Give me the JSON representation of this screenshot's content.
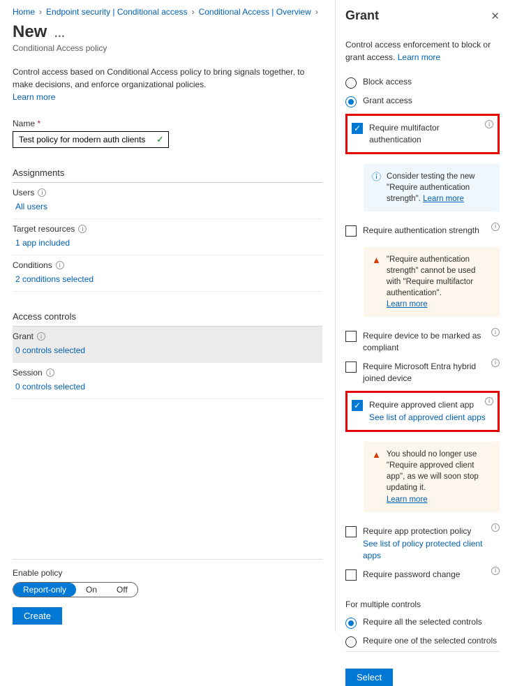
{
  "breadcrumb": [
    "Home",
    "Endpoint security | Conditional access",
    "Conditional Access | Overview"
  ],
  "page": {
    "title": "New",
    "subtitle": "Conditional Access policy",
    "intro": "Control access based on Conditional Access policy to bring signals together, to make decisions, and enforce organizational policies.",
    "learn_more": "Learn more"
  },
  "name": {
    "label": "Name",
    "value": "Test policy for modern auth clients"
  },
  "assignments": {
    "heading": "Assignments",
    "users_label": "Users",
    "users_value": "All users",
    "target_label": "Target resources",
    "target_value": "1 app included",
    "conditions_label": "Conditions",
    "conditions_value": "2 conditions selected"
  },
  "access": {
    "heading": "Access controls",
    "grant_label": "Grant",
    "grant_value": "0 controls selected",
    "session_label": "Session",
    "session_value": "0 controls selected"
  },
  "footer": {
    "enable_label": "Enable policy",
    "opt_report": "Report-only",
    "opt_on": "On",
    "opt_off": "Off",
    "create": "Create"
  },
  "blade": {
    "title": "Grant",
    "desc": "Control access enforcement to block or grant access.",
    "learn_more": "Learn more",
    "block": "Block access",
    "grant": "Grant access",
    "mfa": "Require multifactor authentication",
    "tip_strength": "Consider testing the new \"Require authentication strength\".",
    "strength": "Require authentication strength",
    "warn_strength": "\"Require authentication strength\" cannot be used with \"Require multifactor authentication\".",
    "compliant": "Require device to be marked as compliant",
    "hybrid": "Require Microsoft Entra hybrid joined device",
    "approved_app": "Require approved client app",
    "approved_link": "See list of approved client apps",
    "warn_approved": "You should no longer use \"Require approved client app\", as we will soon stop updating it.",
    "app_protection": "Require app protection policy",
    "app_protection_link": "See list of policy protected client apps",
    "password": "Require password change",
    "multi_heading": "For multiple controls",
    "multi_all": "Require all the selected controls",
    "multi_one": "Require one of the selected controls",
    "select_btn": "Select",
    "learn_more_link": "Learn more"
  }
}
